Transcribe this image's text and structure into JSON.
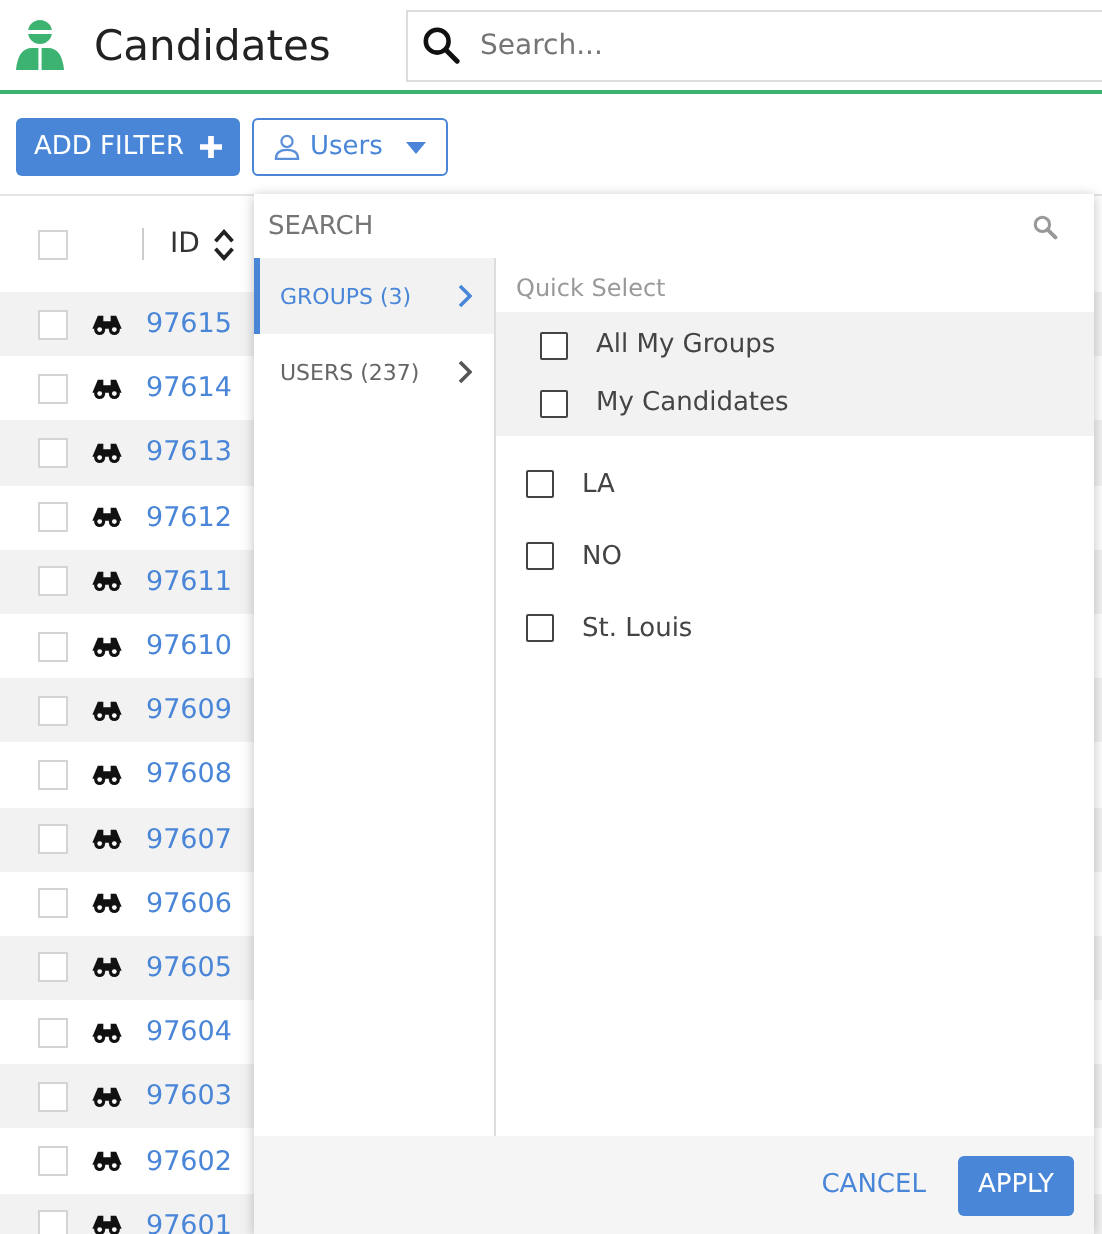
{
  "header": {
    "title": "Candidates",
    "search_placeholder": "Search..."
  },
  "toolbar": {
    "add_filter": "ADD FILTER",
    "users_filter": "Users"
  },
  "table": {
    "header_checked": false,
    "columns": [
      "ID"
    ],
    "rows": [
      {
        "id": "97615",
        "checked": false
      },
      {
        "id": "97614",
        "checked": false
      },
      {
        "id": "97613",
        "checked": false
      },
      {
        "id": "97612",
        "checked": false
      },
      {
        "id": "97611",
        "checked": false
      },
      {
        "id": "97610",
        "checked": false
      },
      {
        "id": "97609",
        "checked": false
      },
      {
        "id": "97608",
        "checked": false
      },
      {
        "id": "97607",
        "checked": false
      },
      {
        "id": "97606",
        "checked": false
      },
      {
        "id": "97605",
        "checked": false
      },
      {
        "id": "97604",
        "checked": false
      },
      {
        "id": "97603",
        "checked": false
      },
      {
        "id": "97602",
        "checked": false
      },
      {
        "id": "97601",
        "checked": false
      }
    ]
  },
  "dropdown": {
    "search_placeholder": "SEARCH",
    "categories": [
      {
        "label": "GROUPS (3)",
        "selected": true
      },
      {
        "label": "USERS (237)",
        "selected": false
      }
    ],
    "quick_select_label": "Quick Select",
    "quick_items": [
      {
        "label": "All My Groups",
        "checked": false
      },
      {
        "label": "My Candidates",
        "checked": false
      }
    ],
    "items": [
      {
        "label": "LA",
        "checked": false
      },
      {
        "label": "NO",
        "checked": false
      },
      {
        "label": "St. Louis",
        "checked": false
      }
    ],
    "cancel": "CANCEL",
    "apply": "APPLY"
  }
}
